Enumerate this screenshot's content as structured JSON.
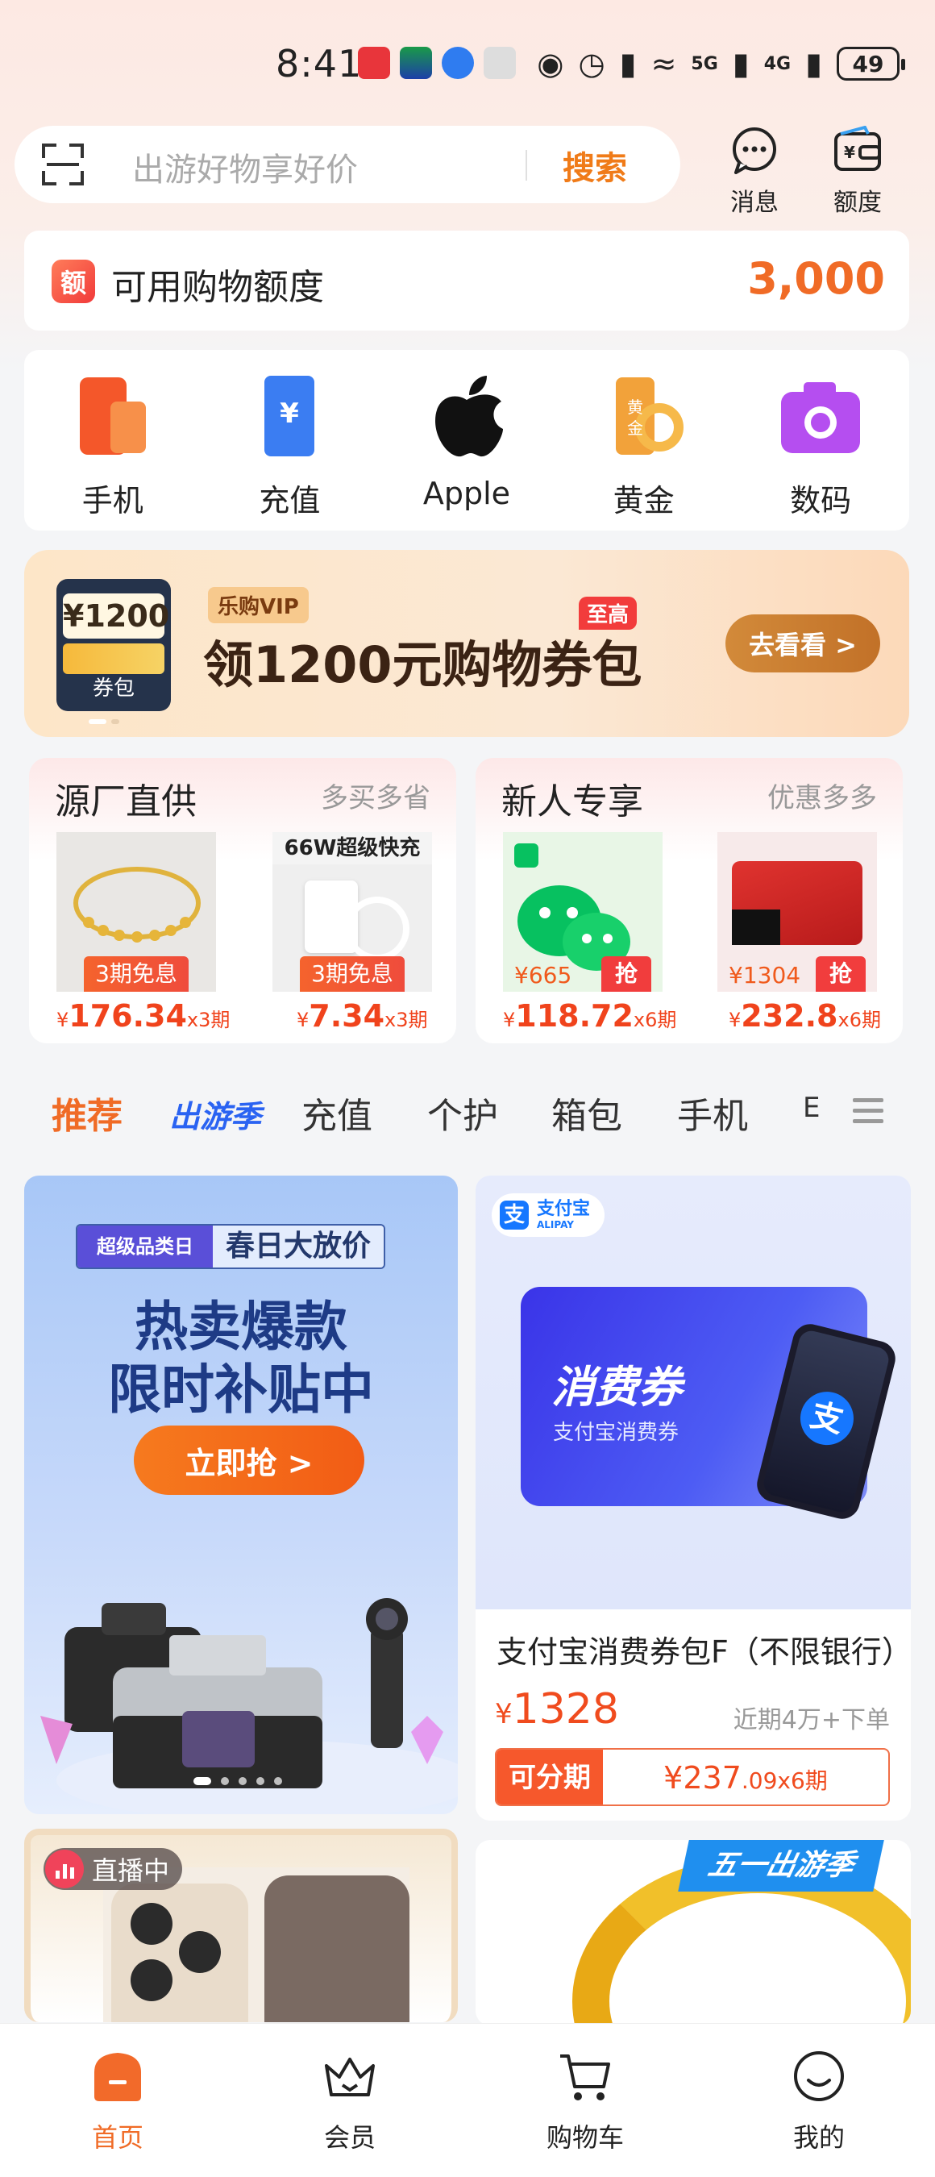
{
  "status_bar": {
    "time": "8:41",
    "network_1": "5G",
    "network_2": "4G",
    "battery": "49"
  },
  "search": {
    "placeholder": "出游好物享好价",
    "button_label": "搜索"
  },
  "top_actions": [
    {
      "label": "消息",
      "icon": "message-icon"
    },
    {
      "label": "额度",
      "icon": "wallet-icon"
    }
  ],
  "credit": {
    "icon_text": "额",
    "label": "可用购物额度",
    "value": "3,000"
  },
  "categories": [
    {
      "label": "手机",
      "icon": "phone-icon",
      "color": "#f4572a"
    },
    {
      "label": "充值",
      "icon": "recharge-icon",
      "color": "#3b7df2"
    },
    {
      "label": "Apple",
      "icon": "apple-icon",
      "color": "#111111"
    },
    {
      "label": "黄金",
      "icon": "gold-icon",
      "color": "#f2a23a"
    },
    {
      "label": "数码",
      "icon": "camera-icon",
      "color": "#b54ef0"
    }
  ],
  "promo": {
    "box_amount": "¥1200",
    "box_label": "券包",
    "vip_tag": "乐购VIP",
    "corner_tag": "至高",
    "title": "领1200元购物券包",
    "button_label": "去看看 >"
  },
  "deals": {
    "left": {
      "title": "源厂直供",
      "subtitle": "多买多省",
      "items": [
        {
          "badge": "3期免息",
          "price": "176.34",
          "period": "x3期"
        },
        {
          "badge": "3期免息",
          "price": "7.34",
          "period": "x3期",
          "img_text": "66W超级快充"
        }
      ]
    },
    "right": {
      "title": "新人专享",
      "subtitle": "优惠多多",
      "items": [
        {
          "overlay_price": "¥665",
          "badge": "抢",
          "price": "118.72",
          "period": "x6期"
        },
        {
          "overlay_price": "¥1304",
          "badge": "抢",
          "price": "232.8",
          "period": "x6期"
        }
      ]
    },
    "currency": "¥"
  },
  "tabs": [
    {
      "label": "推荐",
      "active": true
    },
    {
      "label": "出游季",
      "style": "season"
    },
    {
      "label": "充值"
    },
    {
      "label": "个护"
    },
    {
      "label": "箱包"
    },
    {
      "label": "手机"
    },
    {
      "label": "E"
    }
  ],
  "feed": {
    "banner": {
      "tag_left": "超级品类日",
      "tag_right": "春日大放价",
      "headline_1": "热卖爆款",
      "headline_2": "限时补贴中",
      "button_label": "立即抢 >"
    },
    "product": {
      "brand_cn": "支付宝",
      "brand_en": "ALIPAY",
      "voucher_title": "消费券",
      "voucher_sub": "支付宝消费券",
      "name": "支付宝消费券包F（不限银行）",
      "currency": "¥",
      "price": "1328",
      "sales": "近期4万+下单",
      "installment_label": "可分期",
      "installment_price_main": "¥237",
      "installment_price_dec": ".09x6期"
    },
    "live": {
      "label": "直播中"
    },
    "season_tag": "五一出游季"
  },
  "bottom_nav": [
    {
      "label": "首页",
      "icon": "home-icon",
      "active": true
    },
    {
      "label": "会员",
      "icon": "crown-icon"
    },
    {
      "label": "购物车",
      "icon": "cart-icon"
    },
    {
      "label": "我的",
      "icon": "smile-icon"
    }
  ],
  "colors": {
    "accent": "#f06b26",
    "price": "#f0431c",
    "season_blue": "#2a63f2"
  }
}
